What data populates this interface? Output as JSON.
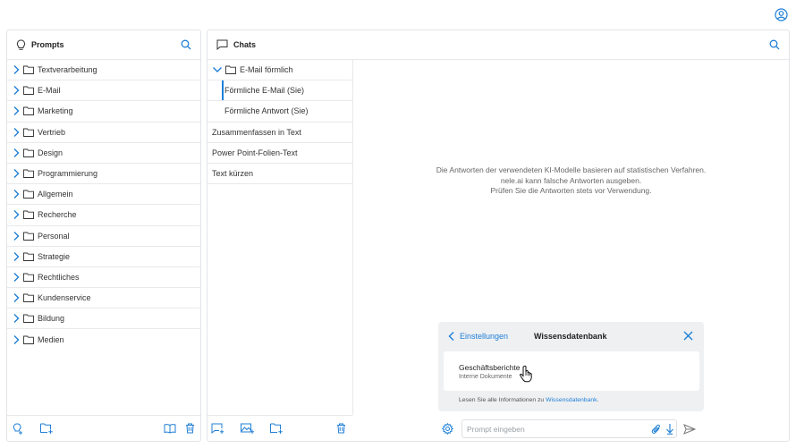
{
  "prompts": {
    "title": "Prompts",
    "folders": [
      "Textverarbeitung",
      "E-Mail",
      "Marketing",
      "Vertrieb",
      "Design",
      "Programmierung",
      "Allgemein",
      "Recherche",
      "Personal",
      "Strategie",
      "Rechtliches",
      "Kundenservice",
      "Bildung",
      "Medien"
    ]
  },
  "chats": {
    "title": "Chats",
    "open_folder": "E-Mail förmlich",
    "sub_items": [
      "Förmliche E-Mail (Sie)",
      "Förmliche Antwort (Sie)"
    ],
    "items": [
      "Zusammenfassen in Text",
      "Power Point-Folien-Text",
      "Text kürzen"
    ]
  },
  "disclaimer": {
    "line1": "Die Antworten der verwendeten KI-Modelle basieren auf statistischen Verfahren.",
    "line2": "nele.ai kann falsche Antworten ausgeben.",
    "line3": "Prüfen Sie die Antworten stets vor Verwendung."
  },
  "knowledge_popup": {
    "back_label": "Einstellungen",
    "title": "Wissensdatenbank",
    "card_name": "Geschäftsberichte",
    "card_sub": "Interne Dokumente",
    "info_text": "Lesen Sie alle Informationen zu ",
    "info_link": "Wissensdatenbank",
    "info_end": "."
  },
  "composer": {
    "placeholder": "Prompt eingeben"
  },
  "colors": {
    "accent": "#1f7fd6",
    "border": "#e2e4e8"
  }
}
